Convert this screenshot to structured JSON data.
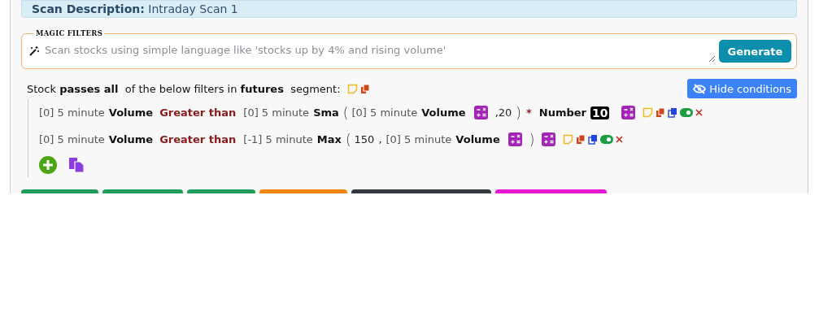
{
  "description": {
    "label": "Scan Description:",
    "value": "Intraday Scan 1"
  },
  "magic_filters": {
    "legend": "MAGIC FILTERS",
    "placeholder": "Scan stocks using simple language like 'stocks up by 4% and rising volume'",
    "button": "Generate"
  },
  "summary": "Stock **passes all**  of the below filters in **futures**  segment:",
  "hide_button": "Hide conditions",
  "conditions": [
    {
      "enabled": true,
      "tokens": [
        {
          "kind": "dim",
          "text": "[0] 5 minute"
        },
        {
          "kind": "bold",
          "text": "Volume"
        },
        {
          "kind": "op",
          "text": "Greater than"
        },
        {
          "kind": "dim",
          "text": "[0] 5 minute"
        },
        {
          "kind": "bold",
          "text": "Sma"
        },
        {
          "kind": "paren",
          "text": "("
        },
        {
          "kind": "dim",
          "text": "[0] 5 minute"
        },
        {
          "kind": "bold",
          "text": "Volume"
        },
        {
          "kind": "calc"
        },
        {
          "kind": "plain",
          "text": ",20"
        },
        {
          "kind": "paren",
          "text": ")"
        },
        {
          "kind": "star",
          "text": "*"
        },
        {
          "kind": "bold",
          "text": "Number"
        },
        {
          "kind": "number",
          "text": "10"
        },
        {
          "kind": "calc"
        }
      ]
    },
    {
      "enabled": true,
      "tokens": [
        {
          "kind": "dim",
          "text": "[0] 5 minute"
        },
        {
          "kind": "bold",
          "text": "Volume"
        },
        {
          "kind": "op",
          "text": "Greater than"
        },
        {
          "kind": "dim",
          "text": "[-1] 5 minute"
        },
        {
          "kind": "bold",
          "text": "Max"
        },
        {
          "kind": "paren",
          "text": "("
        },
        {
          "kind": "plain",
          "text": "150"
        },
        {
          "kind": "plain",
          "text": ","
        },
        {
          "kind": "dim",
          "text": "[0] 5 minute"
        },
        {
          "kind": "bold",
          "text": "Volume"
        },
        {
          "kind": "calc"
        },
        {
          "kind": "paren",
          "text": ")"
        },
        {
          "kind": "calc"
        }
      ]
    }
  ],
  "bottom_buttons": [
    {
      "color": "#1e9e5a"
    },
    {
      "color": "#1e9e5a"
    },
    {
      "color": "#1e9e5a"
    },
    {
      "color": "#f0850f"
    },
    {
      "color": "#343a40"
    },
    {
      "color": "#e817d4"
    }
  ]
}
